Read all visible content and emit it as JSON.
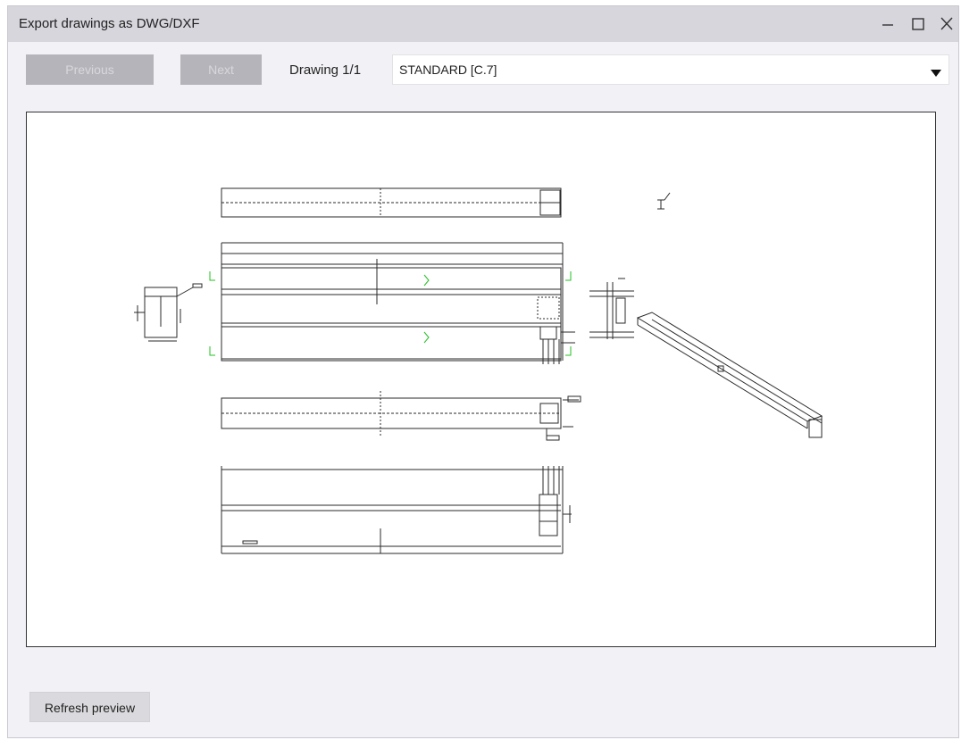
{
  "window": {
    "title": "Export drawings as DWG/DXF",
    "controls": [
      "minimize-icon",
      "maximize-icon",
      "close-icon"
    ]
  },
  "toolbar": {
    "previous_label": "Previous",
    "next_label": "Next",
    "drawing_indicator": "Drawing 1/1",
    "drawing_select": {
      "selected": "STANDARD [C.7]",
      "icon": "chevron-down-icon"
    }
  },
  "footer": {
    "refresh_label": "Refresh preview"
  },
  "colors": {
    "titlebar": "#d6d6dc",
    "window_bg": "#f2f2f6",
    "disabled_button": "#b4b4ba",
    "drawing_line": "#2a2a2a",
    "drawing_accent": "#22c022"
  }
}
